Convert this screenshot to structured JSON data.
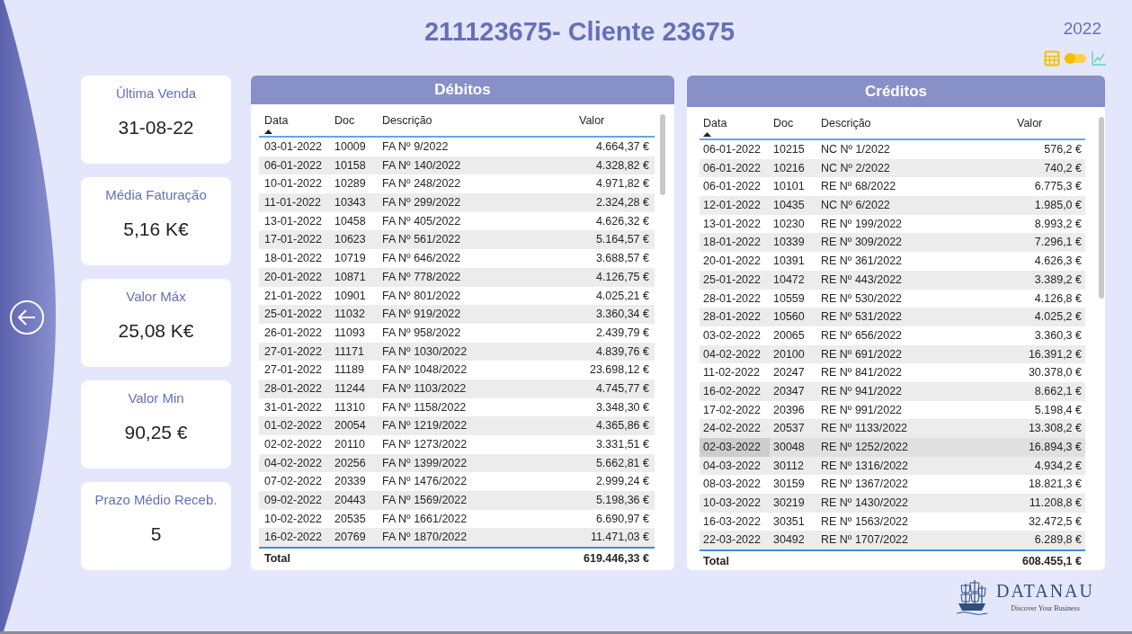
{
  "title": "211123675- Cliente 23675",
  "year": "2022",
  "view_toggle": {
    "on": false
  },
  "kpis": [
    {
      "label": "Última Venda",
      "value": "31-08-22"
    },
    {
      "label": "Média Faturação",
      "value": "5,16 K€"
    },
    {
      "label": "Valor Máx",
      "value": "25,08 K€"
    },
    {
      "label": "Valor Min",
      "value": "90,25 €"
    },
    {
      "label": "Prazo Médio Receb.",
      "value": "5"
    }
  ],
  "tables": [
    {
      "title": "Débitos",
      "columns": [
        "Data",
        "Doc",
        "Descrição",
        "Valor"
      ],
      "total_label": "Total",
      "total": "619.446,33 €",
      "rows": [
        {
          "data": "03-01-2022",
          "doc": "10009",
          "descricao": "FA Nº 9/2022",
          "valor": "4.664,37 €",
          "selected": false
        },
        {
          "data": "06-01-2022",
          "doc": "10158",
          "descricao": "FA Nº 140/2022",
          "valor": "4.328,82 €",
          "selected": false
        },
        {
          "data": "10-01-2022",
          "doc": "10289",
          "descricao": "FA Nº 248/2022",
          "valor": "4.971,82 €",
          "selected": false
        },
        {
          "data": "11-01-2022",
          "doc": "10343",
          "descricao": "FA Nº 299/2022",
          "valor": "2.324,28 €",
          "selected": false
        },
        {
          "data": "13-01-2022",
          "doc": "10458",
          "descricao": "FA Nº 405/2022",
          "valor": "4.626,32 €",
          "selected": false
        },
        {
          "data": "17-01-2022",
          "doc": "10623",
          "descricao": "FA Nº 561/2022",
          "valor": "5.164,57 €",
          "selected": false
        },
        {
          "data": "18-01-2022",
          "doc": "10719",
          "descricao": "FA Nº 646/2022",
          "valor": "3.688,57 €",
          "selected": false
        },
        {
          "data": "20-01-2022",
          "doc": "10871",
          "descricao": "FA Nº 778/2022",
          "valor": "4.126,75 €",
          "selected": false
        },
        {
          "data": "21-01-2022",
          "doc": "10901",
          "descricao": "FA Nº 801/2022",
          "valor": "4.025,21 €",
          "selected": false
        },
        {
          "data": "25-01-2022",
          "doc": "11032",
          "descricao": "FA Nº 919/2022",
          "valor": "3.360,34 €",
          "selected": false
        },
        {
          "data": "26-01-2022",
          "doc": "11093",
          "descricao": "FA Nº 958/2022",
          "valor": "2.439,79 €",
          "selected": false
        },
        {
          "data": "27-01-2022",
          "doc": "11171",
          "descricao": "FA Nº 1030/2022",
          "valor": "4.839,76 €",
          "selected": false
        },
        {
          "data": "27-01-2022",
          "doc": "11189",
          "descricao": "FA Nº 1048/2022",
          "valor": "23.698,12 €",
          "selected": false
        },
        {
          "data": "28-01-2022",
          "doc": "11244",
          "descricao": "FA Nº 1103/2022",
          "valor": "4.745,77 €",
          "selected": false
        },
        {
          "data": "31-01-2022",
          "doc": "11310",
          "descricao": "FA Nº 1158/2022",
          "valor": "3.348,30 €",
          "selected": false
        },
        {
          "data": "01-02-2022",
          "doc": "20054",
          "descricao": "FA Nº 1219/2022",
          "valor": "4.365,86 €",
          "selected": false
        },
        {
          "data": "02-02-2022",
          "doc": "20110",
          "descricao": "FA Nº 1273/2022",
          "valor": "3.331,51 €",
          "selected": false
        },
        {
          "data": "04-02-2022",
          "doc": "20256",
          "descricao": "FA Nº 1399/2022",
          "valor": "5.662,81 €",
          "selected": false
        },
        {
          "data": "07-02-2022",
          "doc": "20339",
          "descricao": "FA Nº 1476/2022",
          "valor": "2.999,24 €",
          "selected": false
        },
        {
          "data": "09-02-2022",
          "doc": "20443",
          "descricao": "FA Nº 1569/2022",
          "valor": "5.198,36 €",
          "selected": false
        },
        {
          "data": "10-02-2022",
          "doc": "20535",
          "descricao": "FA Nº 1661/2022",
          "valor": "6.690,97 €",
          "selected": false
        },
        {
          "data": "16-02-2022",
          "doc": "20769",
          "descricao": "FA Nº 1870/2022",
          "valor": "11.471,03 €",
          "selected": false
        }
      ]
    },
    {
      "title": "Créditos",
      "columns": [
        "Data",
        "Doc",
        "Descrição",
        "Valor"
      ],
      "total_label": "Total",
      "total": "608.455,1 €",
      "rows": [
        {
          "data": "06-01-2022",
          "doc": "10215",
          "descricao": "NC Nº 1/2022",
          "valor": "576,2 €",
          "selected": false
        },
        {
          "data": "06-01-2022",
          "doc": "10216",
          "descricao": "NC Nº 2/2022",
          "valor": "740,2 €",
          "selected": false
        },
        {
          "data": "06-01-2022",
          "doc": "10101",
          "descricao": "RE Nº 68/2022",
          "valor": "6.775,3 €",
          "selected": false
        },
        {
          "data": "12-01-2022",
          "doc": "10435",
          "descricao": "NC Nº 6/2022",
          "valor": "1.985,0 €",
          "selected": false
        },
        {
          "data": "13-01-2022",
          "doc": "10230",
          "descricao": "RE Nº 199/2022",
          "valor": "8.993,2 €",
          "selected": false
        },
        {
          "data": "18-01-2022",
          "doc": "10339",
          "descricao": "RE Nº 309/2022",
          "valor": "7.296,1 €",
          "selected": false
        },
        {
          "data": "20-01-2022",
          "doc": "10391",
          "descricao": "RE Nº 361/2022",
          "valor": "4.626,3 €",
          "selected": false
        },
        {
          "data": "25-01-2022",
          "doc": "10472",
          "descricao": "RE Nº 443/2022",
          "valor": "3.389,2 €",
          "selected": false
        },
        {
          "data": "28-01-2022",
          "doc": "10559",
          "descricao": "RE Nº 530/2022",
          "valor": "4.126,8 €",
          "selected": false
        },
        {
          "data": "28-01-2022",
          "doc": "10560",
          "descricao": "RE Nº 531/2022",
          "valor": "4.025,2 €",
          "selected": false
        },
        {
          "data": "03-02-2022",
          "doc": "20065",
          "descricao": "RE Nº 656/2022",
          "valor": "3.360,3 €",
          "selected": false
        },
        {
          "data": "04-02-2022",
          "doc": "20100",
          "descricao": "RE Nº 691/2022",
          "valor": "16.391,2 €",
          "selected": false
        },
        {
          "data": "11-02-2022",
          "doc": "20247",
          "descricao": "RE Nº 841/2022",
          "valor": "30.378,0 €",
          "selected": false
        },
        {
          "data": "16-02-2022",
          "doc": "20347",
          "descricao": "RE Nº 941/2022",
          "valor": "8.662,1 €",
          "selected": false
        },
        {
          "data": "17-02-2022",
          "doc": "20396",
          "descricao": "RE Nº 991/2022",
          "valor": "5.198,4 €",
          "selected": false
        },
        {
          "data": "24-02-2022",
          "doc": "20537",
          "descricao": "RE Nº 1133/2022",
          "valor": "13.308,2 €",
          "selected": false
        },
        {
          "data": "02-03-2022",
          "doc": "30048",
          "descricao": "RE Nº 1252/2022",
          "valor": "16.894,3 €",
          "selected": true
        },
        {
          "data": "04-03-2022",
          "doc": "30112",
          "descricao": "RE Nº 1316/2022",
          "valor": "4.934,2 €",
          "selected": false
        },
        {
          "data": "08-03-2022",
          "doc": "30159",
          "descricao": "RE Nº 1367/2022",
          "valor": "18.821,3 €",
          "selected": false
        },
        {
          "data": "10-03-2022",
          "doc": "30219",
          "descricao": "RE Nº 1430/2022",
          "valor": "11.208,8 €",
          "selected": false
        },
        {
          "data": "16-03-2022",
          "doc": "30351",
          "descricao": "RE Nº 1563/2022",
          "valor": "32.472,5 €",
          "selected": false
        },
        {
          "data": "22-03-2022",
          "doc": "30492",
          "descricao": "RE Nº 1707/2022",
          "valor": "6.289,8 €",
          "selected": false
        }
      ]
    }
  ],
  "logo": {
    "name": "DATANAU",
    "tagline": "Discover Your Business"
  }
}
